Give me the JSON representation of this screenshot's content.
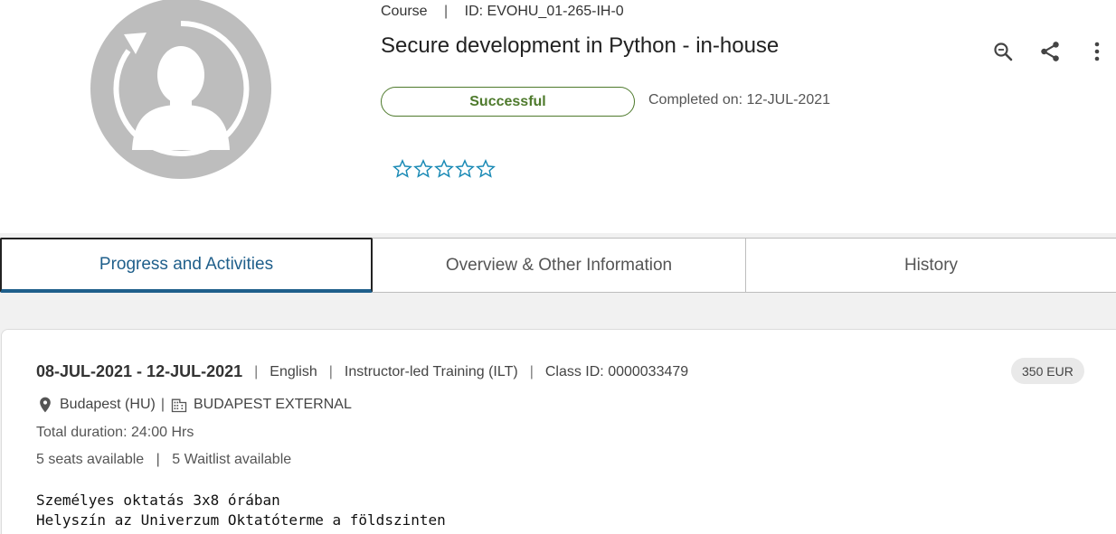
{
  "header": {
    "type_label": "Course",
    "id_label": "ID: EVOHU_01-265-IH-0",
    "title": "Secure development in Python - in-house",
    "status": "Successful",
    "completed_on": "Completed on: 12-JUL-2021",
    "rating": {
      "max": 5,
      "value": 0
    },
    "actions": [
      "zoom-icon",
      "share-icon",
      "more-vertical-icon"
    ]
  },
  "tabs": [
    {
      "label": "Progress and Activities",
      "active": true
    },
    {
      "label": "Overview & Other Information",
      "active": false
    },
    {
      "label": "History",
      "active": false
    }
  ],
  "offering": {
    "dates": "08-JUL-2021 - 12-JUL-2021",
    "language": "English",
    "delivery": "Instructor-led Training (ILT)",
    "class_id": "Class ID: 0000033479",
    "price": "350 EUR",
    "location": "Budapest (HU)",
    "facility": "BUDAPEST EXTERNAL",
    "duration": "Total duration: 24:00 Hrs",
    "seats": "5 seats available",
    "waitlist": "5 Waitlist available",
    "description_lines": [
      "Személyes oktatás 3x8 órában",
      "Helyszín az Univerzum Oktatóterme a földszinten"
    ]
  },
  "colors": {
    "accent": "#1f5f8b",
    "success": "#4e7a2c",
    "star": "#1a8ab5"
  }
}
